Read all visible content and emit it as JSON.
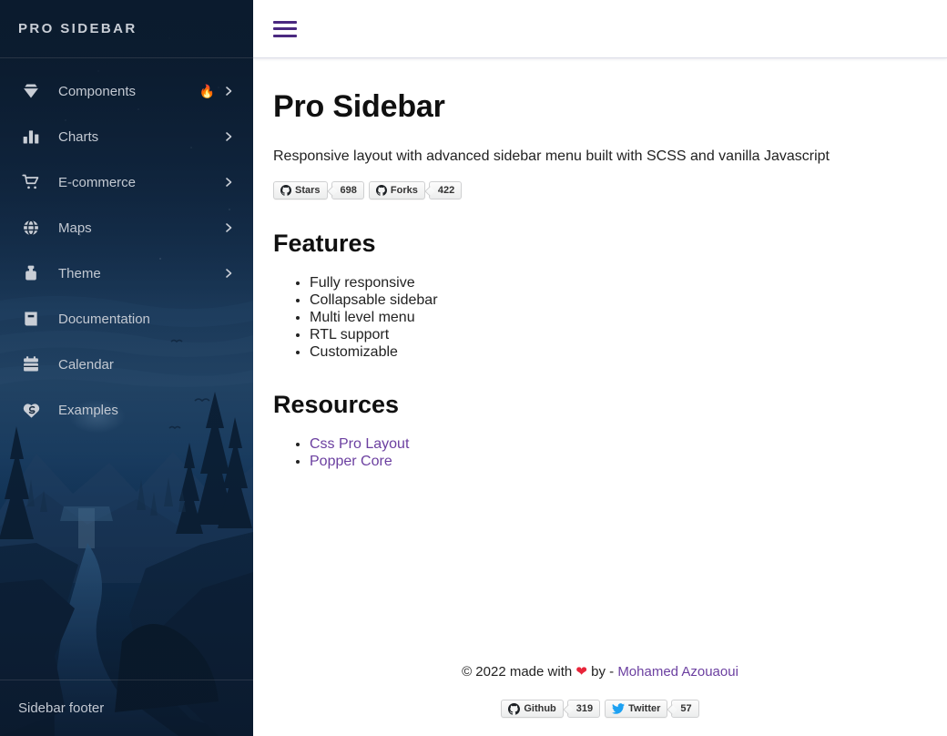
{
  "sidebar": {
    "brand": "PRO SIDEBAR",
    "footer_label": "Sidebar footer",
    "items": [
      {
        "label": "Components",
        "icon": "gem-icon",
        "badge": "🔥",
        "chevron": "›"
      },
      {
        "label": "Charts",
        "icon": "bar-chart-icon",
        "badge": "",
        "chevron": "›"
      },
      {
        "label": "E-commerce",
        "icon": "shopping-cart-icon",
        "badge": "",
        "chevron": "›"
      },
      {
        "label": "Maps",
        "icon": "globe-icon",
        "badge": "",
        "chevron": "›"
      },
      {
        "label": "Theme",
        "icon": "ink-bottle-icon",
        "badge": "",
        "chevron": "›"
      },
      {
        "label": "Documentation",
        "icon": "book-icon",
        "badge": "",
        "chevron": ""
      },
      {
        "label": "Calendar",
        "icon": "calendar-icon",
        "badge": "",
        "chevron": ""
      },
      {
        "label": "Examples",
        "icon": "service-icon",
        "badge": "",
        "chevron": ""
      }
    ]
  },
  "topbar": {
    "menu_toggle_icon": "hamburger-icon"
  },
  "main": {
    "title": "Pro Sidebar",
    "subtitle": "Responsive layout with advanced sidebar menu built with SCSS and vanilla Javascript",
    "badges": [
      {
        "icon": "github-icon",
        "label": "Stars",
        "value": "698"
      },
      {
        "icon": "github-icon",
        "label": "Forks",
        "value": "422"
      }
    ],
    "features": {
      "heading": "Features",
      "items": [
        "Fully responsive",
        "Collapsable sidebar",
        "Multi level menu",
        "RTL support",
        "Customizable"
      ]
    },
    "resources": {
      "heading": "Resources",
      "items": [
        "Css Pro Layout",
        "Popper Core"
      ]
    }
  },
  "footer": {
    "copyright_prefix": "© 2022 made with",
    "heart": "❤",
    "by": "by -",
    "author": "Mohamed Azouaoui",
    "badges": [
      {
        "icon": "github-icon",
        "label": "Github",
        "value": "319"
      },
      {
        "icon": "twitter-icon",
        "label": "Twitter",
        "value": "57"
      }
    ]
  },
  "colors": {
    "sidebar_bg": "#0b1b2e",
    "accent_purple": "#4a2880",
    "link_purple": "#6b3fa0",
    "heart_red": "#e8253a",
    "twitter_blue": "#1da1f2",
    "sidebar_text": "#c3c9d2",
    "divider": "#dcdee8"
  }
}
